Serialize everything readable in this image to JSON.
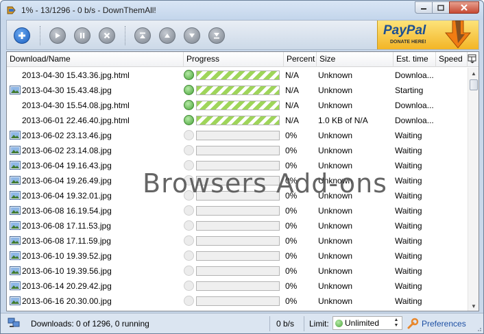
{
  "window": {
    "title": "1% - 13/1296 - 0 b/s - DownThemAll!"
  },
  "toolbar": {
    "buttons": [
      {
        "name": "add-download-button",
        "icon": "plus-icon"
      },
      {
        "name": "resume-button",
        "icon": "play-icon"
      },
      {
        "name": "pause-button",
        "icon": "pause-icon"
      },
      {
        "name": "cancel-button",
        "icon": "x-icon"
      },
      {
        "name": "move-top-button",
        "icon": "move-top-icon"
      },
      {
        "name": "move-up-button",
        "icon": "move-up-icon"
      },
      {
        "name": "move-down-button",
        "icon": "move-down-icon"
      },
      {
        "name": "move-bottom-button",
        "icon": "move-bottom-icon"
      }
    ],
    "paypal": {
      "label": "PayPal",
      "donate": "DONATE HERE!"
    }
  },
  "columns": {
    "name": "Download/Name",
    "progress": "Progress",
    "percent": "Percent",
    "size": "Size",
    "est": "Est. time",
    "speed": "Speed"
  },
  "rows": [
    {
      "name": "2013-04-30 15.43.36.jpg.html",
      "icon": "none",
      "state": "running",
      "progress": 1.0,
      "percent": "N/A",
      "size": "Unknown",
      "est": "Downloa...",
      "speed": ""
    },
    {
      "name": "2013-04-30 15.43.48.jpg",
      "icon": "image-file-icon",
      "state": "running",
      "progress": 1.0,
      "percent": "N/A",
      "size": "Unknown",
      "est": "Starting",
      "speed": ""
    },
    {
      "name": "2013-04-30 15.54.08.jpg.html",
      "icon": "none",
      "state": "running",
      "progress": 1.0,
      "percent": "N/A",
      "size": "Unknown",
      "est": "Downloa...",
      "speed": ""
    },
    {
      "name": "2013-06-01 22.46.40.jpg.html",
      "icon": "none",
      "state": "running",
      "progress": 1.0,
      "percent": "N/A",
      "size": "1.0 KB of N/A",
      "est": "Downloa...",
      "speed": ""
    },
    {
      "name": "2013-06-02 23.13.46.jpg",
      "icon": "image-file-icon",
      "state": "waiting",
      "progress": 0,
      "percent": "0%",
      "size": "Unknown",
      "est": "Waiting",
      "speed": ""
    },
    {
      "name": "2013-06-02 23.14.08.jpg",
      "icon": "image-file-icon",
      "state": "waiting",
      "progress": 0,
      "percent": "0%",
      "size": "Unknown",
      "est": "Waiting",
      "speed": ""
    },
    {
      "name": "2013-06-04 19.16.43.jpg",
      "icon": "image-file-icon",
      "state": "waiting",
      "progress": 0,
      "percent": "0%",
      "size": "Unknown",
      "est": "Waiting",
      "speed": ""
    },
    {
      "name": "2013-06-04 19.26.49.jpg",
      "icon": "image-file-icon",
      "state": "waiting",
      "progress": 0,
      "percent": "0%",
      "size": "Unknown",
      "est": "Waiting",
      "speed": ""
    },
    {
      "name": "2013-06-04 19.32.01.jpg",
      "icon": "image-file-icon",
      "state": "waiting",
      "progress": 0,
      "percent": "0%",
      "size": "Unknown",
      "est": "Waiting",
      "speed": ""
    },
    {
      "name": "2013-06-08 16.19.54.jpg",
      "icon": "image-file-icon",
      "state": "waiting",
      "progress": 0,
      "percent": "0%",
      "size": "Unknown",
      "est": "Waiting",
      "speed": ""
    },
    {
      "name": "2013-06-08 17.11.53.jpg",
      "icon": "image-file-icon",
      "state": "waiting",
      "progress": 0,
      "percent": "0%",
      "size": "Unknown",
      "est": "Waiting",
      "speed": ""
    },
    {
      "name": "2013-06-08 17.11.59.jpg",
      "icon": "image-file-icon",
      "state": "waiting",
      "progress": 0,
      "percent": "0%",
      "size": "Unknown",
      "est": "Waiting",
      "speed": ""
    },
    {
      "name": "2013-06-10 19.39.52.jpg",
      "icon": "image-file-icon",
      "state": "waiting",
      "progress": 0,
      "percent": "0%",
      "size": "Unknown",
      "est": "Waiting",
      "speed": ""
    },
    {
      "name": "2013-06-10 19.39.56.jpg",
      "icon": "image-file-icon",
      "state": "waiting",
      "progress": 0,
      "percent": "0%",
      "size": "Unknown",
      "est": "Waiting",
      "speed": ""
    },
    {
      "name": "2013-06-14 20.29.42.jpg",
      "icon": "image-file-icon",
      "state": "waiting",
      "progress": 0,
      "percent": "0%",
      "size": "Unknown",
      "est": "Waiting",
      "speed": ""
    },
    {
      "name": "2013-06-16 20.30.00.jpg",
      "icon": "image-file-icon",
      "state": "waiting",
      "progress": 0,
      "percent": "0%",
      "size": "Unknown",
      "est": "Waiting",
      "speed": ""
    }
  ],
  "watermark": "Browsers Add-ons",
  "status": {
    "downloads": "Downloads: 0 of 1296, 0 running",
    "speed": "0 b/s",
    "limit_label": "Limit:",
    "limit_value": "Unlimited",
    "preferences": "Preferences"
  },
  "colors": {
    "progress_stripe": "#9fd55a",
    "running": "#49a43a",
    "link": "#1c4fa3",
    "paypal_bg": "#f3b526"
  }
}
